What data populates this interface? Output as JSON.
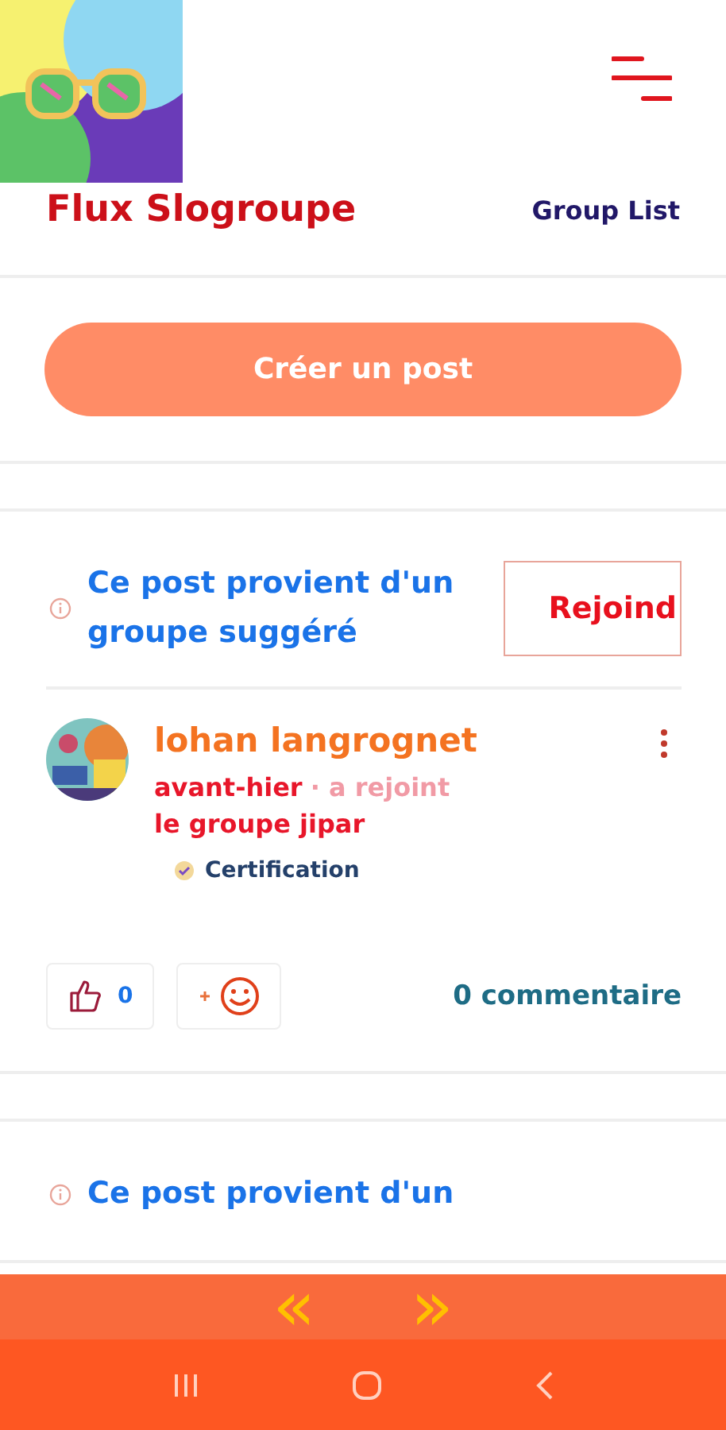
{
  "header": {
    "title": "Flux Slogroupe",
    "group_list_link": "Group List"
  },
  "create_post_button": "Créer un post",
  "posts": [
    {
      "suggestion": "Ce post provient d'un groupe suggéré",
      "join_button": "Rejoind",
      "author": "lohan langrognet",
      "time": "avant-hier",
      "action": "· a rejoint",
      "group": "le groupe jipar",
      "badge": "Certification",
      "likes": "0",
      "comments": "0 commentaire"
    },
    {
      "suggestion": "Ce post provient d'un"
    }
  ],
  "pager": {
    "prev": "«",
    "next": "»"
  }
}
